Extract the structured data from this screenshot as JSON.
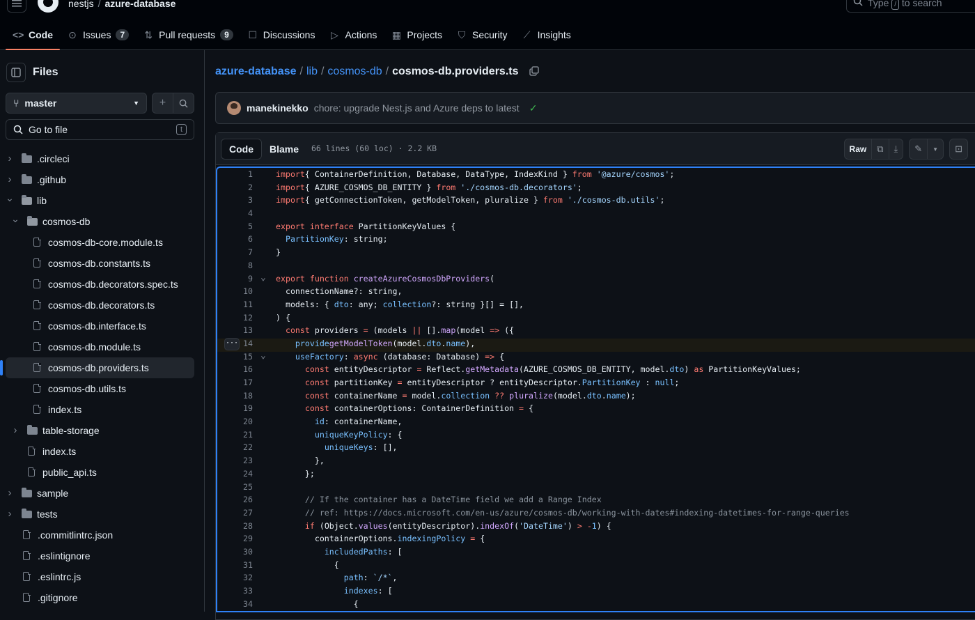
{
  "header": {
    "owner": "nestjs",
    "separator": "/",
    "repo": "azure-database",
    "search_placeholder": "Type",
    "search_key": "/",
    "search_suffix": "to search"
  },
  "tabs": [
    {
      "label": "Code",
      "icon": "code-icon",
      "active": true
    },
    {
      "label": "Issues",
      "icon": "issue-icon",
      "count": "7"
    },
    {
      "label": "Pull requests",
      "icon": "pull-request-icon",
      "count": "9"
    },
    {
      "label": "Discussions",
      "icon": "discussion-icon"
    },
    {
      "label": "Actions",
      "icon": "play-icon"
    },
    {
      "label": "Projects",
      "icon": "table-icon"
    },
    {
      "label": "Security",
      "icon": "shield-icon"
    },
    {
      "label": "Insights",
      "icon": "graph-icon"
    }
  ],
  "sidebar": {
    "title": "Files",
    "branch": "master",
    "goto_placeholder": "Go to file",
    "goto_key": "t",
    "tree": [
      {
        "name": ".circleci",
        "type": "dir",
        "depth": 0,
        "expanded": false
      },
      {
        "name": ".github",
        "type": "dir",
        "depth": 0,
        "expanded": false
      },
      {
        "name": "lib",
        "type": "dir",
        "depth": 0,
        "expanded": true
      },
      {
        "name": "cosmos-db",
        "type": "dir",
        "depth": 1,
        "expanded": true
      },
      {
        "name": "cosmos-db-core.module.ts",
        "type": "file",
        "depth": 2
      },
      {
        "name": "cosmos-db.constants.ts",
        "type": "file",
        "depth": 2
      },
      {
        "name": "cosmos-db.decorators.spec.ts",
        "type": "file",
        "depth": 2
      },
      {
        "name": "cosmos-db.decorators.ts",
        "type": "file",
        "depth": 2
      },
      {
        "name": "cosmos-db.interface.ts",
        "type": "file",
        "depth": 2
      },
      {
        "name": "cosmos-db.module.ts",
        "type": "file",
        "depth": 2
      },
      {
        "name": "cosmos-db.providers.ts",
        "type": "file",
        "depth": 2,
        "selected": true
      },
      {
        "name": "cosmos-db.utils.ts",
        "type": "file",
        "depth": 2
      },
      {
        "name": "index.ts",
        "type": "file",
        "depth": 2
      },
      {
        "name": "table-storage",
        "type": "dir",
        "depth": 1,
        "expanded": false
      },
      {
        "name": "index.ts",
        "type": "file",
        "depth": 1
      },
      {
        "name": "public_api.ts",
        "type": "file",
        "depth": 1
      },
      {
        "name": "sample",
        "type": "dir",
        "depth": 0,
        "expanded": false
      },
      {
        "name": "tests",
        "type": "dir",
        "depth": 0,
        "expanded": false
      },
      {
        "name": ".commitlintrc.json",
        "type": "file",
        "depth": 0
      },
      {
        "name": ".eslintignore",
        "type": "file",
        "depth": 0
      },
      {
        "name": ".eslintrc.js",
        "type": "file",
        "depth": 0
      },
      {
        "name": ".gitignore",
        "type": "file",
        "depth": 0
      }
    ]
  },
  "breadcrumb": {
    "repo": "azure-database",
    "dir1": "lib",
    "dir2": "cosmos-db",
    "file": "cosmos-db.providers.ts",
    "sep": "/"
  },
  "commit": {
    "author": "manekinekko",
    "message": "chore: upgrade Nest.js and Azure deps to latest",
    "status": "✓"
  },
  "file": {
    "view_code": "Code",
    "view_blame": "Blame",
    "meta": "66 lines (60 loc) · 2.2 KB",
    "raw_label": "Raw"
  },
  "code": [
    {
      "n": "1",
      "t": [
        [
          "k",
          "import"
        ],
        [
          "",
          "{ ContainerDefinition, Database, DataType, IndexKind } "
        ],
        [
          "k",
          "from"
        ],
        [
          "",
          " "
        ],
        [
          "s",
          "'@azure/cosmos'"
        ],
        [
          "",
          ";"
        ]
      ]
    },
    {
      "n": "2",
      "t": [
        [
          "k",
          "import"
        ],
        [
          "",
          "{ AZURE_COSMOS_DB_ENTITY } "
        ],
        [
          "k",
          "from"
        ],
        [
          "",
          " "
        ],
        [
          "s",
          "'./cosmos-db.decorators'"
        ],
        [
          "",
          ";"
        ]
      ]
    },
    {
      "n": "3",
      "t": [
        [
          "k",
          "import"
        ],
        [
          "",
          "{ getConnectionToken, getModelToken, pluralize } "
        ],
        [
          "k",
          "from"
        ],
        [
          "",
          " "
        ],
        [
          "s",
          "'./cosmos-db.utils'"
        ],
        [
          "",
          ";"
        ]
      ]
    },
    {
      "n": "4",
      "t": []
    },
    {
      "n": "5",
      "t": [
        [
          "k",
          "export interface"
        ],
        [
          "",
          " PartitionKeyValues {"
        ]
      ]
    },
    {
      "n": "6",
      "t": [
        [
          "",
          "  "
        ],
        [
          "p",
          "PartitionKey"
        ],
        [
          "",
          ": string;"
        ]
      ]
    },
    {
      "n": "7",
      "t": [
        [
          "",
          "}"
        ]
      ]
    },
    {
      "n": "8",
      "t": []
    },
    {
      "n": "9",
      "fold": true,
      "t": [
        [
          "k",
          "export function"
        ],
        [
          "",
          " "
        ],
        [
          "f",
          "createAzureCosmosDbProviders"
        ],
        [
          "",
          "("
        ]
      ]
    },
    {
      "n": "10",
      "t": [
        [
          "",
          "  connectionName?: string,"
        ]
      ]
    },
    {
      "n": "11",
      "t": [
        [
          "",
          "  models: { "
        ],
        [
          "p",
          "dto"
        ],
        [
          "",
          ": any; "
        ],
        [
          "p",
          "collection"
        ],
        [
          "",
          "?: string }[] = [],"
        ]
      ]
    },
    {
      "n": "12",
      "t": [
        [
          "",
          ") {"
        ]
      ]
    },
    {
      "n": "13",
      "t": [
        [
          "",
          "  "
        ],
        [
          "k",
          "const"
        ],
        [
          "",
          " providers "
        ],
        [
          "k",
          "="
        ],
        [
          "",
          " (models "
        ],
        [
          "k",
          "||"
        ],
        [
          "",
          " []"
        ],
        [
          "",
          "."
        ],
        [
          "f",
          "map"
        ],
        [
          "",
          "(model "
        ],
        [
          "k",
          "=>"
        ],
        [
          "",
          " ({"
        ]
      ]
    },
    {
      "n": "14",
      "hl": true,
      "more": true,
      "t": [
        [
          "",
          "    "
        ],
        [
          "p",
          "provide"
        ],
        [
          ": ",
          ""
        ],
        [
          "f",
          "getModelToken"
        ],
        [
          "",
          "(model."
        ],
        [
          "p",
          "dto"
        ],
        [
          "",
          "."
        ],
        [
          "p",
          "name"
        ],
        [
          "",
          "),"
        ]
      ]
    },
    {
      "n": "15",
      "fold": true,
      "t": [
        [
          "",
          "    "
        ],
        [
          "p",
          "useFactory"
        ],
        [
          "",
          ": "
        ],
        [
          "k",
          "async"
        ],
        [
          "",
          " (database: Database) "
        ],
        [
          "k",
          "=>"
        ],
        [
          "",
          " {"
        ]
      ]
    },
    {
      "n": "16",
      "t": [
        [
          "",
          "      "
        ],
        [
          "k",
          "const"
        ],
        [
          "",
          " entityDescriptor "
        ],
        [
          "k",
          "="
        ],
        [
          "",
          " Reflect."
        ],
        [
          "f",
          "getMetadata"
        ],
        [
          "",
          "(AZURE_COSMOS_DB_ENTITY, model."
        ],
        [
          "p",
          "dto"
        ],
        [
          "",
          ") "
        ],
        [
          "k",
          "as"
        ],
        [
          "",
          " PartitionKeyValues;"
        ]
      ]
    },
    {
      "n": "17",
      "t": [
        [
          "",
          "      "
        ],
        [
          "k",
          "const"
        ],
        [
          "",
          " partitionKey "
        ],
        [
          "k",
          "="
        ],
        [
          "",
          " entityDescriptor ? entityDescriptor."
        ],
        [
          "p",
          "PartitionKey"
        ],
        [
          "",
          " : "
        ],
        [
          "p",
          "null"
        ],
        [
          "",
          ";"
        ]
      ]
    },
    {
      "n": "18",
      "t": [
        [
          "",
          "      "
        ],
        [
          "k",
          "const"
        ],
        [
          "",
          " containerName "
        ],
        [
          "k",
          "="
        ],
        [
          "",
          " model."
        ],
        [
          "p",
          "collection"
        ],
        [
          "",
          " "
        ],
        [
          "k",
          "??"
        ],
        [
          "",
          " "
        ],
        [
          "f",
          "pluralize"
        ],
        [
          "",
          "(model."
        ],
        [
          "p",
          "dto"
        ],
        [
          "",
          "."
        ],
        [
          "p",
          "name"
        ],
        [
          "",
          "); "
        ]
      ]
    },
    {
      "n": "19",
      "t": [
        [
          "",
          "      "
        ],
        [
          "k",
          "const"
        ],
        [
          "",
          " containerOptions: ContainerDefinition "
        ],
        [
          "k",
          "="
        ],
        [
          "",
          " {"
        ]
      ]
    },
    {
      "n": "20",
      "t": [
        [
          "",
          "        "
        ],
        [
          "p",
          "id"
        ],
        [
          "",
          ": containerName,"
        ]
      ]
    },
    {
      "n": "21",
      "t": [
        [
          "",
          "        "
        ],
        [
          "p",
          "uniqueKeyPolicy"
        ],
        [
          "",
          ": {"
        ]
      ]
    },
    {
      "n": "22",
      "t": [
        [
          "",
          "          "
        ],
        [
          "p",
          "uniqueKeys"
        ],
        [
          "",
          ": [],"
        ]
      ]
    },
    {
      "n": "23",
      "t": [
        [
          "",
          "        },"
        ]
      ]
    },
    {
      "n": "24",
      "t": [
        [
          "",
          "      };"
        ]
      ]
    },
    {
      "n": "25",
      "t": []
    },
    {
      "n": "26",
      "t": [
        [
          "",
          "      "
        ],
        [
          "c",
          "// If the container has a DateTime field we add a Range Index"
        ]
      ]
    },
    {
      "n": "27",
      "t": [
        [
          "",
          "      "
        ],
        [
          "c",
          "// ref: https://docs.microsoft.com/en-us/azure/cosmos-db/working-with-dates#indexing-datetimes-for-range-queries"
        ]
      ]
    },
    {
      "n": "28",
      "t": [
        [
          "",
          "      "
        ],
        [
          "k",
          "if"
        ],
        [
          "",
          " (Object."
        ],
        [
          "f",
          "values"
        ],
        [
          "",
          "(entityDescriptor)."
        ],
        [
          "f",
          "indexOf"
        ],
        [
          "",
          "("
        ],
        [
          "s",
          "'DateTime'"
        ],
        [
          "",
          ") "
        ],
        [
          "k",
          ">"
        ],
        [
          "",
          " "
        ],
        [
          "k",
          "-"
        ],
        [
          "p",
          "1"
        ],
        [
          "",
          ") {"
        ]
      ]
    },
    {
      "n": "29",
      "t": [
        [
          "",
          "        containerOptions."
        ],
        [
          "p",
          "indexingPolicy"
        ],
        [
          "",
          " "
        ],
        [
          "k",
          "="
        ],
        [
          "",
          " {"
        ]
      ]
    },
    {
      "n": "30",
      "t": [
        [
          "",
          "          "
        ],
        [
          "p",
          "includedPaths"
        ],
        [
          "",
          ": ["
        ]
      ]
    },
    {
      "n": "31",
      "t": [
        [
          "",
          "            {"
        ]
      ]
    },
    {
      "n": "32",
      "t": [
        [
          "",
          "              "
        ],
        [
          "p",
          "path"
        ],
        [
          "",
          ": "
        ],
        [
          "s",
          "`/*`"
        ],
        [
          "",
          ","
        ]
      ]
    },
    {
      "n": "33",
      "t": [
        [
          "",
          "              "
        ],
        [
          "p",
          "indexes"
        ],
        [
          "",
          ": ["
        ]
      ]
    },
    {
      "n": "34",
      "t": [
        [
          "",
          "                {"
        ]
      ]
    }
  ]
}
